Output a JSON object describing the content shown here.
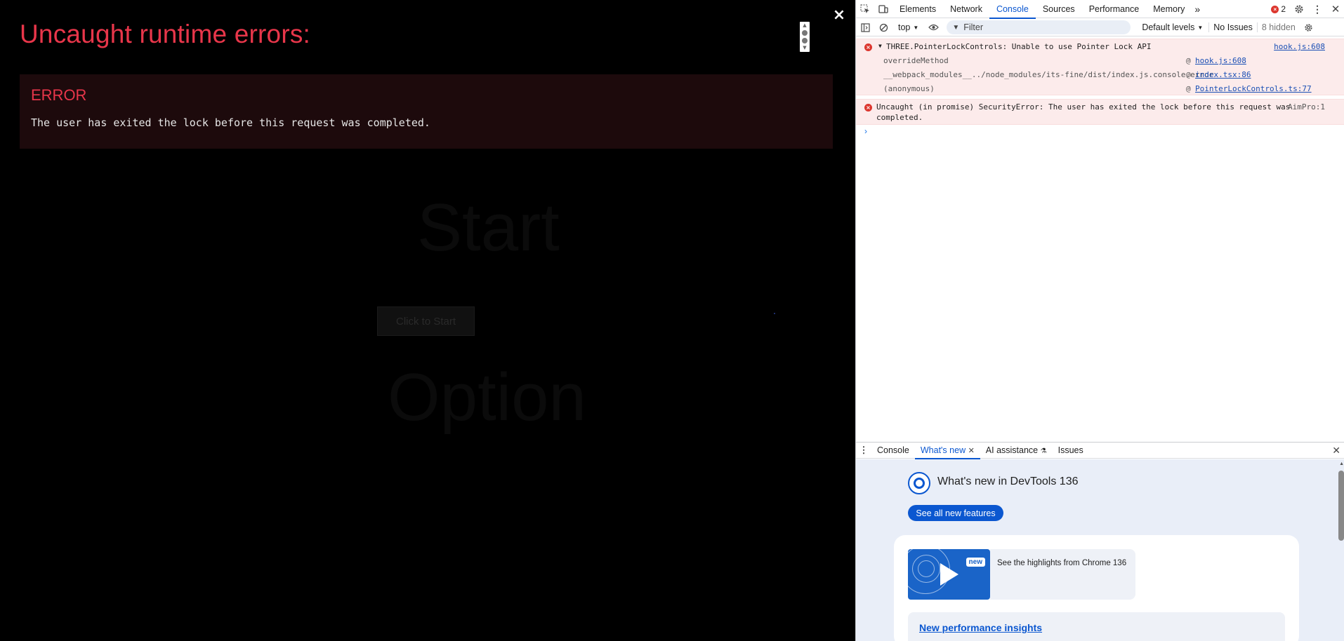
{
  "app": {
    "background_heading": "Start",
    "background_button": "Click to Start",
    "background_heading2": "Option"
  },
  "overlay": {
    "title": "Uncaught runtime errors:",
    "close_label": "×",
    "error_heading": "ERROR",
    "error_message": "The user has exited the lock before this request was completed."
  },
  "devtools": {
    "tabs": [
      "Elements",
      "Network",
      "Console",
      "Sources",
      "Performance",
      "Memory"
    ],
    "active_tab": "Console",
    "more_tabs": "»",
    "error_count": "2",
    "toolbar": {
      "context": "top",
      "filter_placeholder": "Filter",
      "levels": "Default levels",
      "issues": "No Issues",
      "hidden": "8 hidden"
    },
    "messages": [
      {
        "text": "THREE.PointerLockControls: Unable to use Pointer Lock API",
        "source": "hook.js:608",
        "stack": [
          {
            "fn": "overrideMethod",
            "src": "hook.js:608"
          },
          {
            "fn": "__webpack_modules__../node_modules/its-fine/dist/index.js.console.error",
            "src": "index.tsx:86"
          },
          {
            "fn": "(anonymous)",
            "src": "PointerLockControls.ts:77"
          }
        ]
      },
      {
        "text_line1": "Uncaught (in promise) SecurityError: The user has exited the lock before this request was",
        "text_line2": "completed.",
        "source": "AimPro:1"
      }
    ],
    "prompt": "›",
    "drawer": {
      "tabs": [
        "Console",
        "What's new",
        "AI assistance",
        "Issues"
      ],
      "active_tab": "What's new",
      "whats_new_title": "What's new in DevTools 136",
      "see_all_button": "See all new features",
      "new_badge": "new",
      "highlight_text": "See the highlights from Chrome 136",
      "perf_link": "New performance insights"
    },
    "colors": {
      "accent": "#0b57d0",
      "error_red": "#dc362e",
      "overlay_red": "#e8364a"
    }
  }
}
